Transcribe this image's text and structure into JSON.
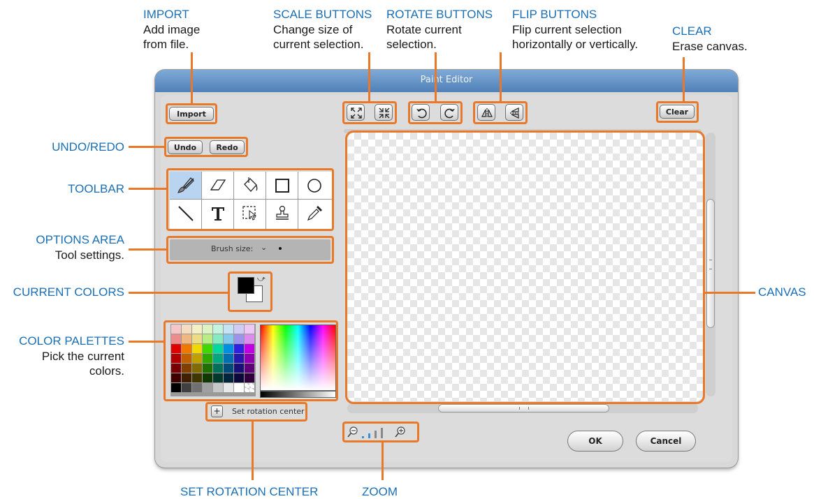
{
  "annotations": {
    "import": {
      "title": "IMPORT",
      "desc": [
        "Add image",
        "from file."
      ]
    },
    "scale": {
      "title": "SCALE BUTTONS",
      "desc": [
        "Change size of",
        "current selection."
      ]
    },
    "rotate": {
      "title": "ROTATE BUTTONS",
      "desc": [
        "Rotate current",
        "selection."
      ]
    },
    "flip": {
      "title": "FLIP BUTTONS",
      "desc": [
        "Flip current selection",
        "horizontally or vertically."
      ]
    },
    "clear": {
      "title": "CLEAR",
      "desc": [
        "Erase canvas."
      ]
    },
    "undo_redo": {
      "title": "UNDO/REDO"
    },
    "toolbar": {
      "title": "TOOLBAR"
    },
    "options": {
      "title": "OPTIONS AREA",
      "desc": [
        "Tool settings."
      ]
    },
    "current_colors": {
      "title": "CURRENT COLORS"
    },
    "palettes": {
      "title": "COLOR PALETTES",
      "desc": [
        "Pick the current",
        "colors."
      ]
    },
    "canvas": {
      "title": "CANVAS"
    },
    "rotation_center": {
      "title": "SET ROTATION CENTER"
    },
    "zoom": {
      "title": "ZOOM"
    }
  },
  "window": {
    "title": "Paint Editor",
    "import_label": "Import",
    "undo_label": "Undo",
    "redo_label": "Redo",
    "clear_label": "Clear",
    "brush_size_label": "Brush size:",
    "rotation_center_label": "Set rotation center",
    "ok_label": "OK",
    "cancel_label": "Cancel",
    "tools": [
      "brush-icon",
      "eraser-icon",
      "fill-bucket-icon",
      "rectangle-icon",
      "ellipse-icon",
      "line-icon",
      "text-icon",
      "select-icon",
      "stamp-icon",
      "eyedropper-icon"
    ],
    "foreground_color": "#000000",
    "background_color": "#ffffff",
    "palette": [
      [
        "#f4c8c8",
        "#f4dcc0",
        "#f4f0c4",
        "#dcf4c4",
        "#c4f4e0",
        "#c4e4f4",
        "#d0ccf4",
        "#ecc8f4"
      ],
      [
        "#ec8c8c",
        "#eeb880",
        "#ecdc84",
        "#b8ec84",
        "#84ecc0",
        "#84c8ec",
        "#9c94ec",
        "#dc8cec"
      ],
      [
        "#e00000",
        "#f07800",
        "#f0d800",
        "#40d800",
        "#00d8a0",
        "#0090e0",
        "#3020e0",
        "#c000e0"
      ],
      [
        "#b00000",
        "#c06000",
        "#c0a000",
        "#30a800",
        "#00a880",
        "#0070b0",
        "#2818b0",
        "#9000b0"
      ],
      [
        "#780000",
        "#804000",
        "#806c00",
        "#207000",
        "#007058",
        "#004c78",
        "#181078",
        "#600078"
      ],
      [
        "#400000",
        "#402000",
        "#403600",
        "#103800",
        "#00382c",
        "#00263c",
        "#0c083c",
        "#30003c"
      ],
      [
        "#000000",
        "#404040",
        "#707070",
        "#a0a0a0",
        "#c8c8c8",
        "#e8e8e8",
        "#ffffff",
        "transparent"
      ]
    ],
    "colors": {
      "accent": "#e8782a",
      "title_blue": "#1b6fb5",
      "titlebar": "#5c8cc4"
    }
  }
}
